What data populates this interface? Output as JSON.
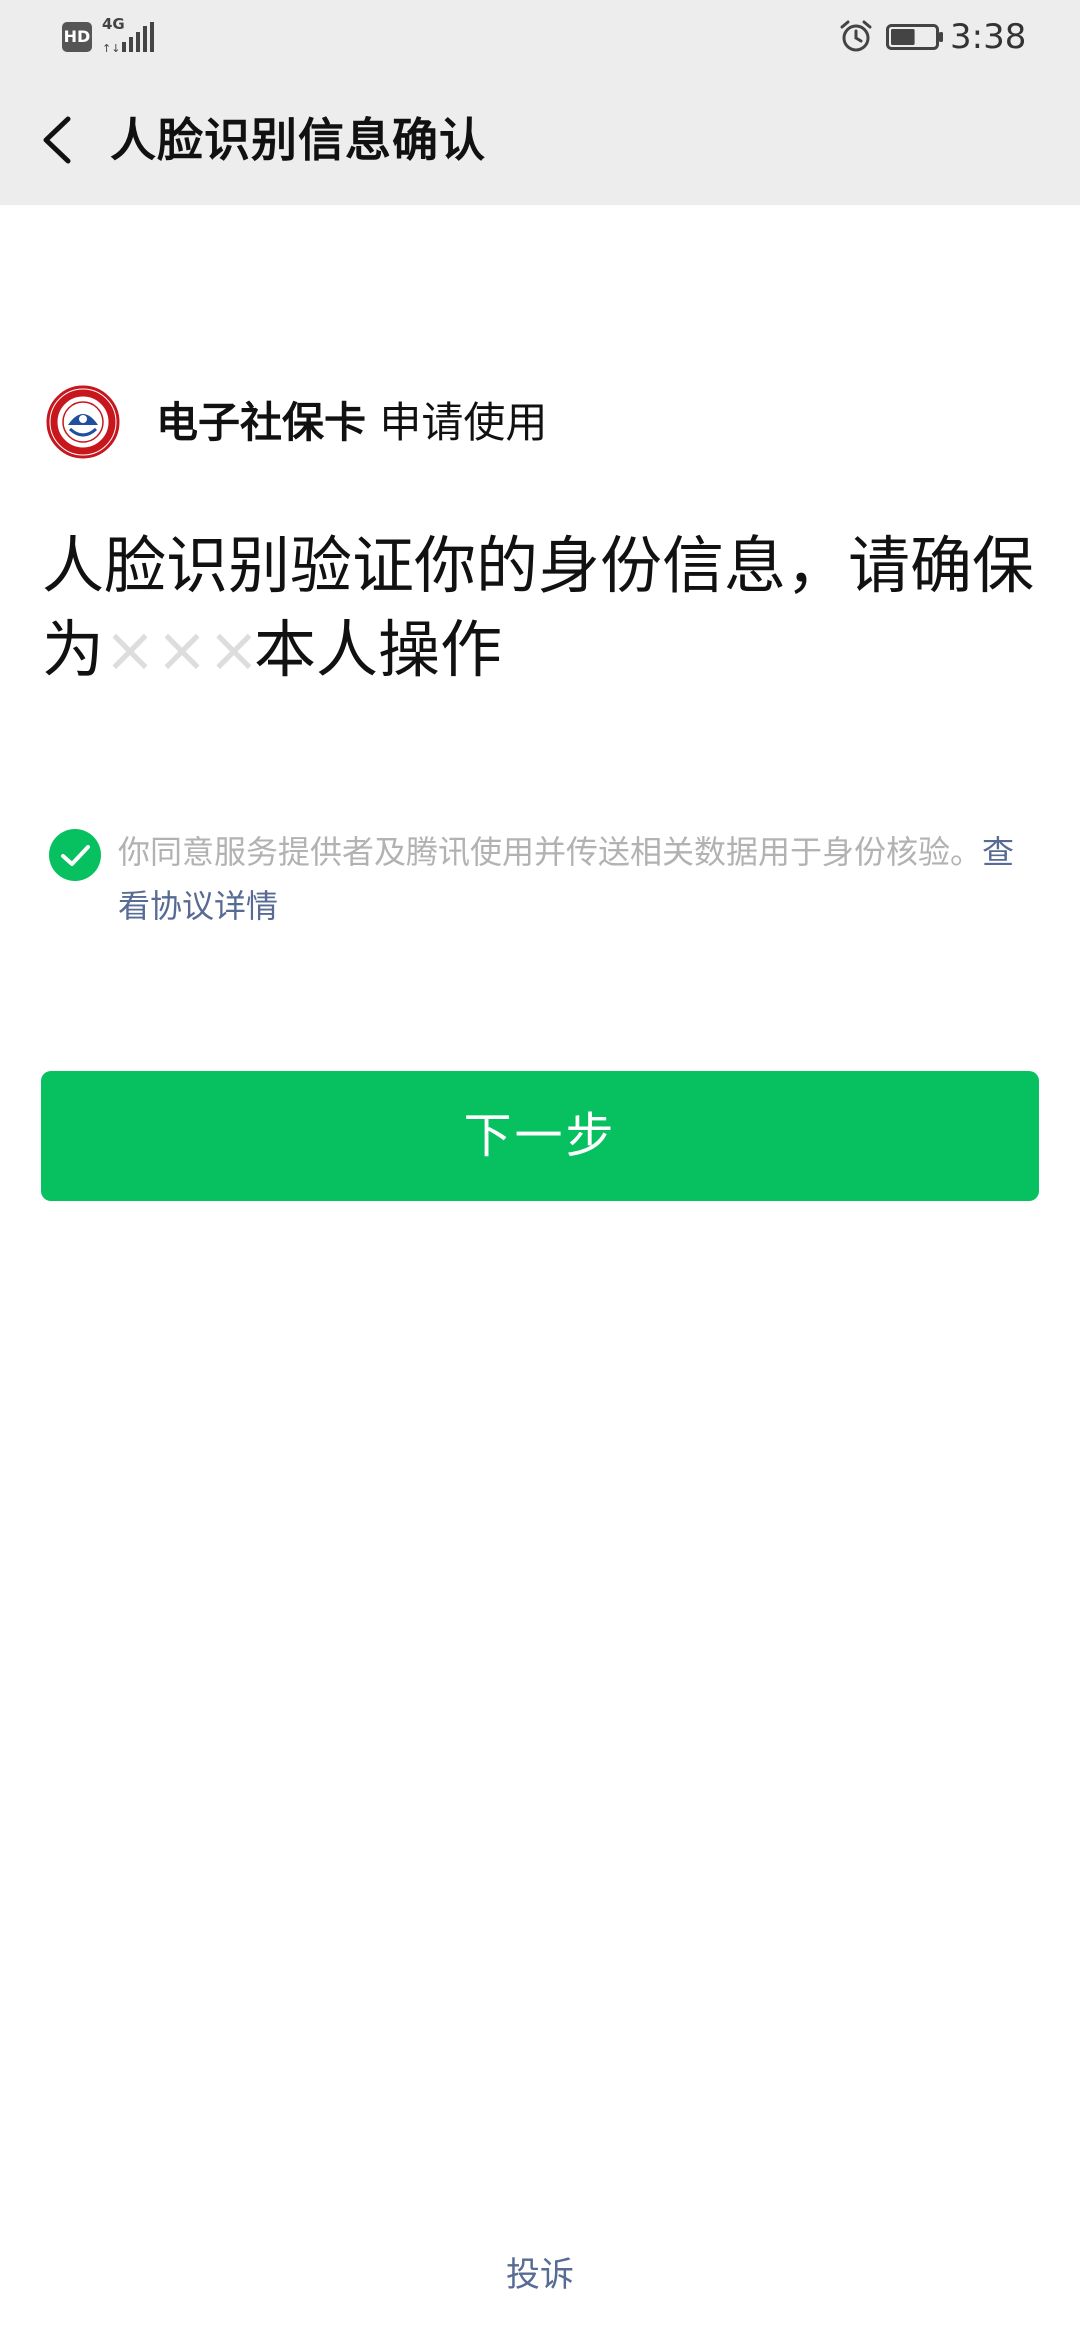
{
  "status_bar": {
    "hd_label": "HD",
    "network_type": "4G",
    "time": "3:38",
    "battery_percent": 55
  },
  "nav": {
    "title": "人脸识别信息确认"
  },
  "applicant": {
    "name": "电子社保卡",
    "action": " 申请使用"
  },
  "headline": {
    "part1": "人脸识别验证你的身份信息，请确保为",
    "masked_name": "×××",
    "part2": "本人操作"
  },
  "consent": {
    "checked": true,
    "text": "你同意服务提供者及腾讯使用并传送相关数据用于身份核验。",
    "link_text": "查看协议详情"
  },
  "next_button": {
    "label": "下一步"
  },
  "footer": {
    "complaint_label": "投诉"
  },
  "colors": {
    "primary_green": "#07c160",
    "link_blue": "#576b95",
    "header_bg": "#ededed",
    "logo_red": "#c8161d"
  },
  "icons": {
    "back": "chevron-left-icon",
    "check": "check-circle-icon",
    "alarm": "alarm-icon",
    "battery": "battery-icon",
    "signal": "signal-icon",
    "logo": "social-security-card-logo"
  }
}
